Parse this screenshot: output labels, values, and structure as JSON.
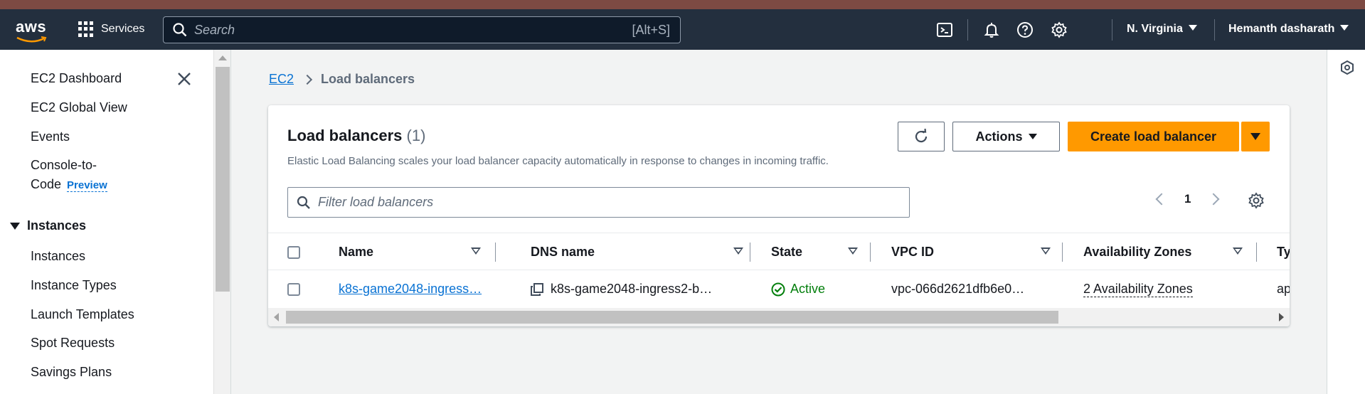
{
  "topnav": {
    "logo_text": "aws",
    "services_label": "Services",
    "search_placeholder": "Search",
    "search_shortcut": "[Alt+S]",
    "region": "N. Virginia",
    "user": "Hemanth dasharath",
    "icons": [
      "cloudshell-icon",
      "bell-icon",
      "help-icon",
      "gear-icon"
    ]
  },
  "sidebar": {
    "items": [
      "EC2 Dashboard",
      "EC2 Global View",
      "Events"
    ],
    "console_to_code_line1": "Console-to-",
    "console_to_code_line2": "Code",
    "preview_badge": "Preview",
    "section_title": "Instances",
    "section_items": [
      "Instances",
      "Instance Types",
      "Launch Templates",
      "Spot Requests",
      "Savings Plans"
    ]
  },
  "breadcrumb": {
    "root": "EC2",
    "current": "Load balancers"
  },
  "panel": {
    "title": "Load balancers",
    "count": "(1)",
    "description": "Elastic Load Balancing scales your load balancer capacity automatically in response to changes in incoming traffic.",
    "actions_label": "Actions",
    "create_label": "Create load balancer",
    "filter_placeholder": "Filter load balancers",
    "page_number": "1"
  },
  "table": {
    "columns": [
      "Name",
      "DNS name",
      "State",
      "VPC ID",
      "Availability Zones",
      "Ty"
    ],
    "rows": [
      {
        "name": "k8s-game2048-ingress…",
        "dns": "k8s-game2048-ingress2-b…",
        "state": "Active",
        "vpc": "vpc-066d2621dfb6e0…",
        "azs": "2 Availability Zones",
        "type": "ap"
      }
    ]
  },
  "colors": {
    "nav_bg": "#232f3e",
    "primary_button": "#ff9900",
    "link": "#0972d3",
    "success": "#037f0c"
  }
}
